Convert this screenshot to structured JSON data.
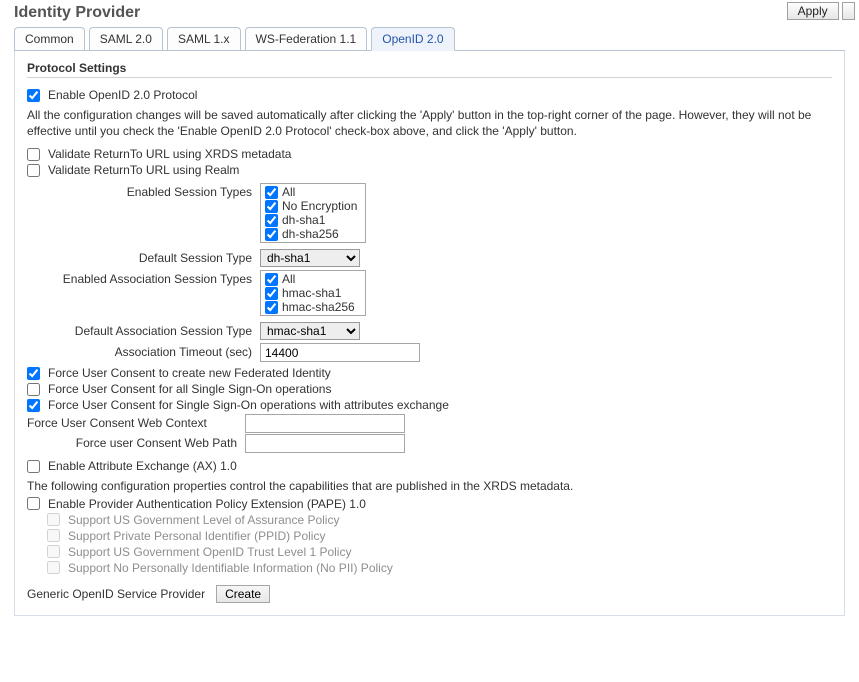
{
  "header": {
    "title": "Identity Provider",
    "apply_label": "Apply"
  },
  "tabs": {
    "common": "Common",
    "saml20": "SAML 2.0",
    "saml1x": "SAML 1.x",
    "wsfed": "WS-Federation 1.1",
    "openid20": "OpenID 2.0"
  },
  "section": {
    "title": "Protocol Settings"
  },
  "enable_protocol": {
    "checked": true,
    "label": "Enable OpenID 2.0 Protocol"
  },
  "config_note": "All the configuration changes will be saved automatically after clicking the 'Apply' button in the top-right corner of the page. However, they will not be effective until you check the 'Enable OpenID 2.0 Protocol' check-box above, and click the 'Apply' button.",
  "validate_xrds": {
    "checked": false,
    "label": "Validate ReturnTo URL using XRDS metadata"
  },
  "validate_realm": {
    "checked": false,
    "label": "Validate ReturnTo URL using Realm"
  },
  "enabled_session_types": {
    "label": "Enabled Session Types",
    "options": [
      {
        "label": "All",
        "checked": true
      },
      {
        "label": "No Encryption",
        "checked": true
      },
      {
        "label": "dh-sha1",
        "checked": true
      },
      {
        "label": "dh-sha256",
        "checked": true
      }
    ]
  },
  "default_session_type": {
    "label": "Default Session Type",
    "value": "dh-sha1"
  },
  "enabled_assoc_types": {
    "label": "Enabled Association Session Types",
    "options": [
      {
        "label": "All",
        "checked": true
      },
      {
        "label": "hmac-sha1",
        "checked": true
      },
      {
        "label": "hmac-sha256",
        "checked": true
      }
    ]
  },
  "default_assoc_type": {
    "label": "Default Association Session Type",
    "value": "hmac-sha1"
  },
  "assoc_timeout": {
    "label": "Association Timeout (sec)",
    "value": "14400"
  },
  "force_consent_new": {
    "checked": true,
    "label": "Force User Consent to create new Federated Identity"
  },
  "force_consent_all": {
    "checked": false,
    "label": "Force User Consent for all Single Sign-On operations"
  },
  "force_consent_attr": {
    "checked": true,
    "label": "Force User Consent for Single Sign-On operations with attributes exchange"
  },
  "consent_web_context": {
    "label": "Force User Consent Web Context",
    "value": ""
  },
  "consent_web_path": {
    "label": "Force user Consent Web Path",
    "value": ""
  },
  "enable_ax": {
    "checked": false,
    "label": "Enable Attribute Exchange (AX) 1.0"
  },
  "xrds_note": "The following configuration properties control the capabilities that are published in the XRDS metadata.",
  "enable_pape": {
    "checked": false,
    "label": "Enable Provider Authentication Policy Extension (PAPE) 1.0"
  },
  "pape_options": [
    {
      "label": "Support US Government Level of Assurance Policy",
      "checked": false
    },
    {
      "label": "Support Private Personal Identifier (PPID) Policy",
      "checked": false
    },
    {
      "label": "Support US Government OpenID Trust Level 1 Policy",
      "checked": false
    },
    {
      "label": "Support No Personally Identifiable Information (No PII) Policy",
      "checked": false
    }
  ],
  "generic_provider": {
    "label": "Generic OpenID Service Provider",
    "button": "Create"
  }
}
